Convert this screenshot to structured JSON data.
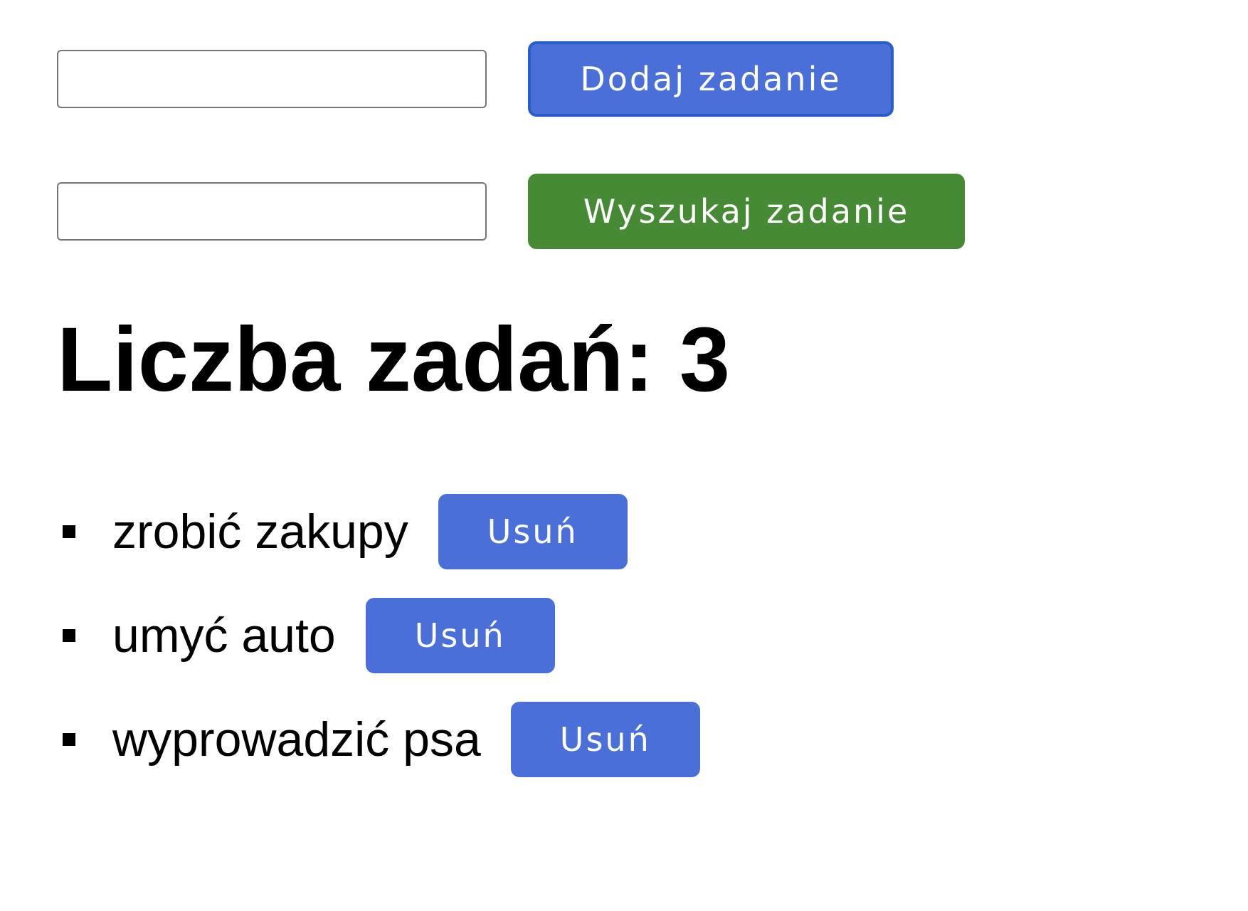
{
  "add_form": {
    "input_value": "",
    "button_label": "Dodaj zadanie"
  },
  "search_form": {
    "input_value": "",
    "button_label": "Wyszukaj zadanie"
  },
  "counter": {
    "label": "Liczba zadań:",
    "value": "3"
  },
  "tasks": [
    {
      "text": "zrobić zakupy",
      "delete_label": "Usuń"
    },
    {
      "text": "umyć auto",
      "delete_label": "Usuń"
    },
    {
      "text": "wyprowadzić psa",
      "delete_label": "Usuń"
    }
  ],
  "colors": {
    "add_button": "#4a6fd8",
    "search_button": "#468a36",
    "delete_button": "#4a6fd8"
  }
}
